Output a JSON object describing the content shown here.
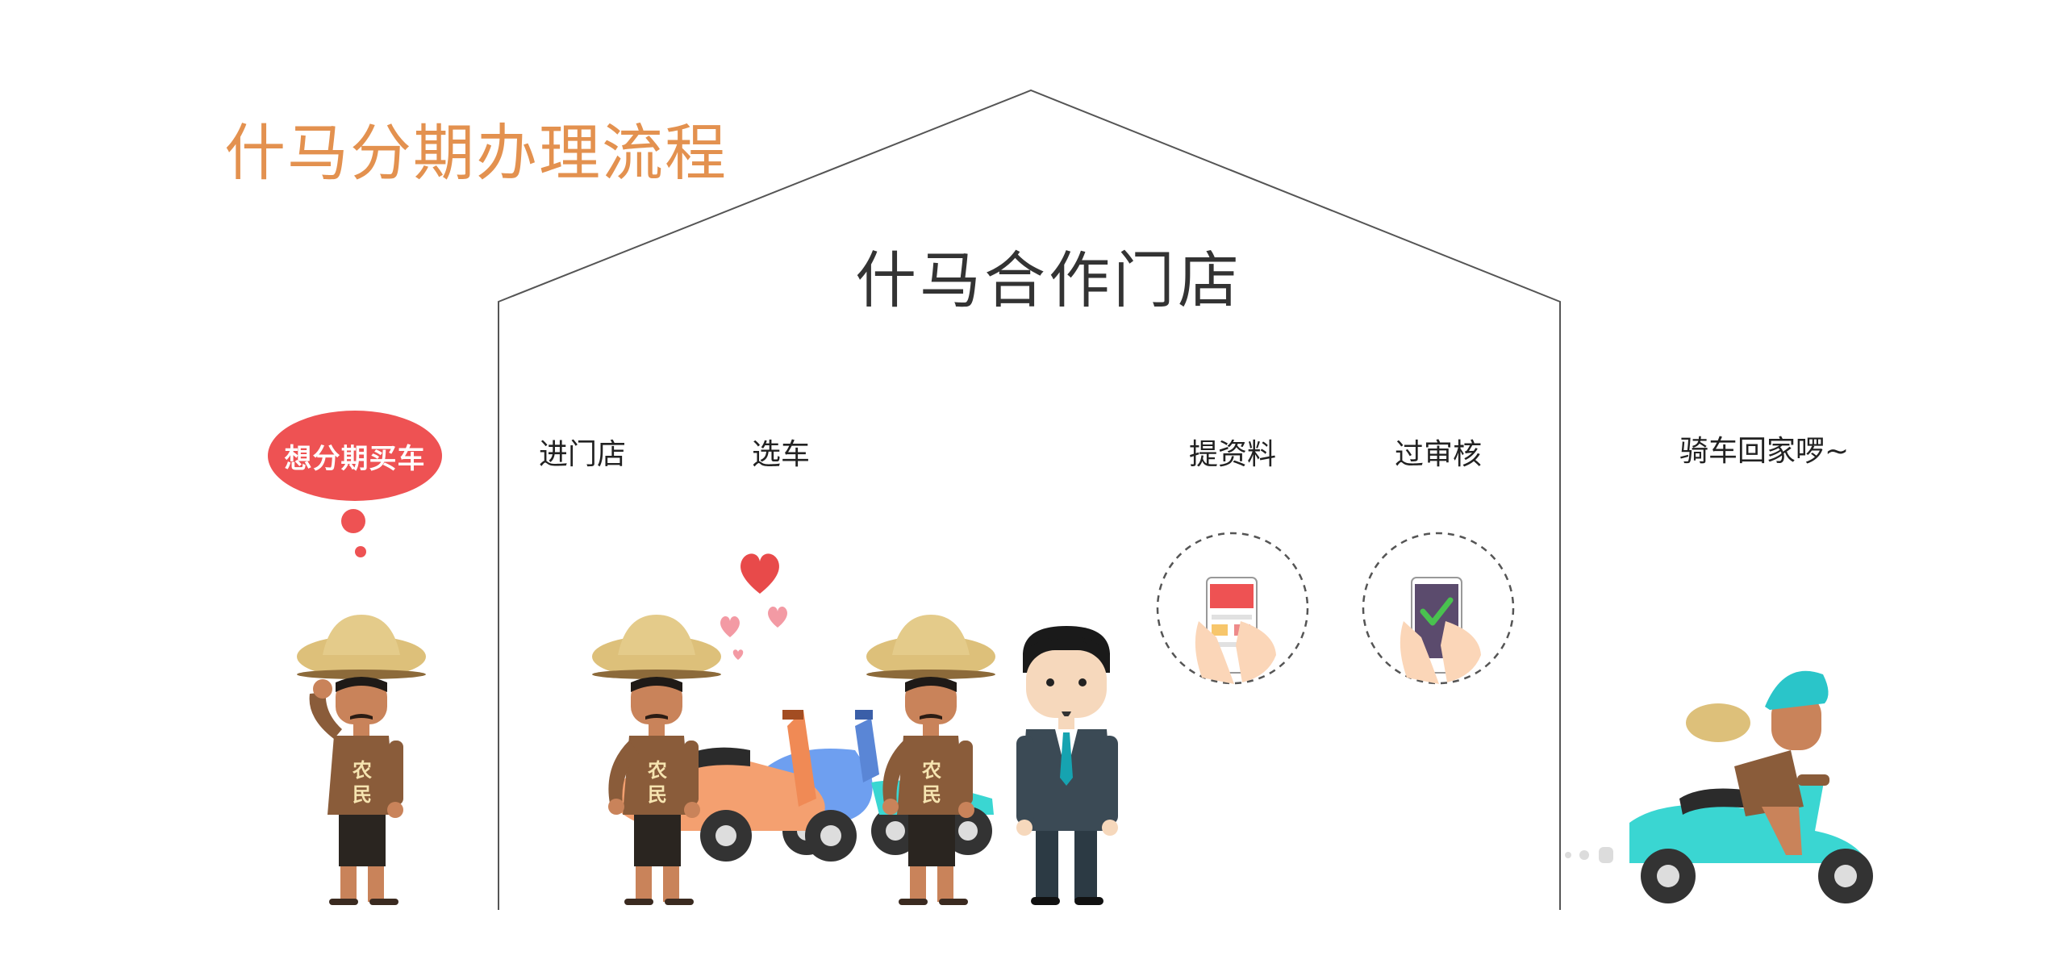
{
  "page_title": "什马分期办理流程",
  "store": {
    "title": "什马合作门店"
  },
  "thought_bubble": {
    "text": "想分期买车"
  },
  "steps": [
    {
      "label": "进门店"
    },
    {
      "label": "选车"
    },
    {
      "label": "提资料"
    },
    {
      "label": "过审核"
    }
  ],
  "ending": {
    "label": "骑车回家啰~"
  },
  "shirt_text": {
    "line1": "农",
    "line2": "民"
  },
  "colors": {
    "title_orange": "#e3914f",
    "bubble_red": "#ee5253",
    "heart_red": "#e84a4a",
    "heart_pink": "#f39aa4",
    "house_line": "#555555",
    "scooter_orange": "#f4a070",
    "scooter_blue": "#6e9ff0",
    "scooter_cyan": "#3ad6d2",
    "helmet_cyan": "#2ac5c9",
    "sombrero": "#ddc07a",
    "shirt_brown": "#8a5c3a",
    "suit": "#3b4a55"
  }
}
